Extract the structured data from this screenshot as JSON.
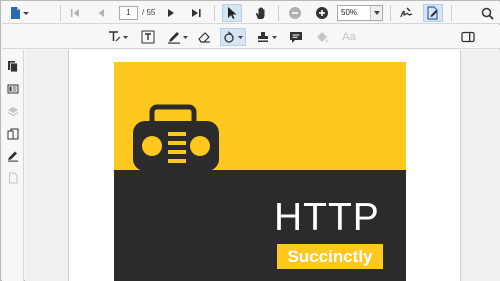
{
  "toolbar": {
    "current_page": "1",
    "page_total": "/ 55",
    "zoom_value": "50%"
  },
  "annotation_toolbar": {
    "text_style_label": "Aa"
  },
  "document": {
    "cover_title": "HTTP",
    "cover_subtitle": "Succinctly",
    "cover_top_color": "#ffc81e",
    "cover_bottom_color": "#2b2b2b"
  },
  "icons": {
    "file_menu": "file-icon",
    "first_page": "first-page-icon",
    "prev_page": "previous-page-icon",
    "next_page": "next-page-icon",
    "last_page": "last-page-icon",
    "select_tool": "cursor-arrow-icon",
    "pan_tool": "hand-icon",
    "zoom_out": "zoom-out-icon",
    "zoom_in": "zoom-in-icon",
    "search": "search-icon"
  }
}
